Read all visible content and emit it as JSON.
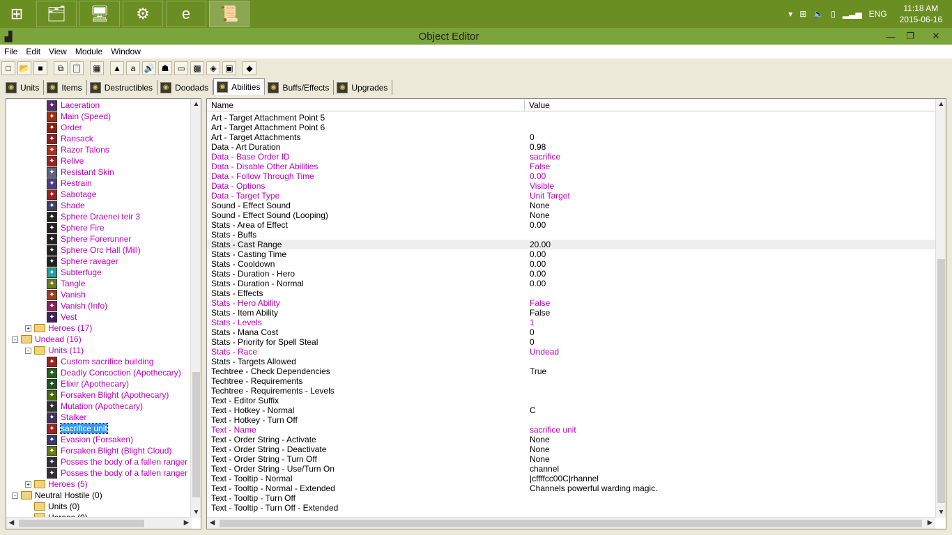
{
  "taskbar": {
    "apps": [
      {
        "name": "start-button",
        "glyph": "⊞"
      },
      {
        "name": "file-explorer",
        "glyph": "🗂"
      },
      {
        "name": "system-monitor",
        "glyph": "🖥"
      },
      {
        "name": "control-panel",
        "glyph": "⚙"
      },
      {
        "name": "internet-explorer",
        "glyph": "e"
      },
      {
        "name": "world-editor",
        "glyph": "📜"
      }
    ],
    "language": "ENG",
    "time": "11:18 AM",
    "date": "2015-06-16"
  },
  "window": {
    "title": "Object Editor"
  },
  "menu": [
    "File",
    "Edit",
    "View",
    "Module",
    "Window"
  ],
  "tabs": [
    {
      "label": "Units",
      "active": false
    },
    {
      "label": "Items",
      "active": false
    },
    {
      "label": "Destructibles",
      "active": false
    },
    {
      "label": "Doodads",
      "active": false
    },
    {
      "label": "Abilities",
      "active": true
    },
    {
      "label": "Buffs/Effects",
      "active": false
    },
    {
      "label": "Upgrades",
      "active": false
    }
  ],
  "tree": [
    {
      "label": "Laceration",
      "indent": 3,
      "icon": "#5a2a6a"
    },
    {
      "label": "Main (Speed)",
      "indent": 3,
      "icon": "#a03010"
    },
    {
      "label": "Order",
      "indent": 3,
      "icon": "#8a2010"
    },
    {
      "label": "Ransack",
      "indent": 3,
      "icon": "#902020"
    },
    {
      "label": "Razor Talons",
      "indent": 3,
      "icon": "#b03020"
    },
    {
      "label": "Relive",
      "indent": 3,
      "icon": "#a02020"
    },
    {
      "label": "Resistant Skin",
      "indent": 3,
      "icon": "#606080"
    },
    {
      "label": "Restrain",
      "indent": 3,
      "icon": "#4a3a8a"
    },
    {
      "label": "Sabotage",
      "indent": 3,
      "icon": "#a02020"
    },
    {
      "label": "Shade",
      "indent": 3,
      "icon": "#404060"
    },
    {
      "label": "Sphere Draenei teir 3",
      "indent": 3,
      "icon": "#222222"
    },
    {
      "label": "Sphere Fire",
      "indent": 3,
      "icon": "#222222"
    },
    {
      "label": "Sphere Forerunner",
      "indent": 3,
      "icon": "#222222"
    },
    {
      "label": "Sphere Orc Hall (Mill)",
      "indent": 3,
      "icon": "#222222"
    },
    {
      "label": "Sphere ravager",
      "indent": 3,
      "icon": "#222222"
    },
    {
      "label": "Subterfuge",
      "indent": 3,
      "icon": "#20a0a0"
    },
    {
      "label": "Tangle",
      "indent": 3,
      "icon": "#6a7a20"
    },
    {
      "label": "Vanish",
      "indent": 3,
      "icon": "#a04020"
    },
    {
      "label": "Vanish (Info)",
      "indent": 3,
      "icon": "#8a2060"
    },
    {
      "label": "Vest",
      "indent": 3,
      "icon": "#402060"
    },
    {
      "label": "Heroes (17)",
      "indent": 2,
      "folder": true,
      "exp": "+"
    },
    {
      "label": "Undead (16)",
      "indent": 1,
      "folder": true,
      "exp": "-"
    },
    {
      "label": "Units (11)",
      "indent": 2,
      "folder": true,
      "exp": "-"
    },
    {
      "label": "Custom sacrifice building",
      "indent": 3,
      "icon": "#a02020"
    },
    {
      "label": "Deadly Concoction (Apothecary)",
      "indent": 3,
      "icon": "#206020"
    },
    {
      "label": "Elixir (Apothecary)",
      "indent": 3,
      "icon": "#205020"
    },
    {
      "label": "Forsaken Blight (Apothecary)",
      "indent": 3,
      "icon": "#4a6a10"
    },
    {
      "label": "Mutation (Apothecary)",
      "indent": 3,
      "icon": "#303030"
    },
    {
      "label": "Stalker",
      "indent": 3,
      "icon": "#403060"
    },
    {
      "label": "sacrifice unit",
      "indent": 3,
      "icon": "#a02020",
      "selected": true
    },
    {
      "label": "Evasion (Forsaken)",
      "indent": 3,
      "icon": "#3a3a6a"
    },
    {
      "label": "Forsaken Blight  (Blight Cloud)",
      "indent": 3,
      "icon": "#6a7a10"
    },
    {
      "label": "Posses the body of a fallen ranger (Ban",
      "indent": 3,
      "icon": "#303030"
    },
    {
      "label": "Posses the body of a fallen ranger (Tom",
      "indent": 3,
      "icon": "#303030"
    },
    {
      "label": "Heroes (5)",
      "indent": 2,
      "folder": true,
      "exp": "+"
    },
    {
      "label": "Neutral Hostile (0)",
      "indent": 1,
      "folder": true,
      "exp": "-",
      "black": true
    },
    {
      "label": "Units (0)",
      "indent": 2,
      "folder": true,
      "black": true
    },
    {
      "label": "Heroes (0)",
      "indent": 2,
      "folder": true,
      "black": true
    }
  ],
  "props_header": {
    "name": "Name",
    "value": "Value"
  },
  "props": [
    {
      "n": "Art - Target Attachment Point 5",
      "v": ""
    },
    {
      "n": "Art - Target Attachment Point 6",
      "v": ""
    },
    {
      "n": "Art - Target Attachments",
      "v": "0"
    },
    {
      "n": "Data - Art Duration",
      "v": "0.98"
    },
    {
      "n": "Data - Base Order ID",
      "v": "sacrifice",
      "mod": true
    },
    {
      "n": "Data - Disable Other Abilities",
      "v": "False",
      "mod": true
    },
    {
      "n": "Data - Follow Through Time",
      "v": "0.00",
      "mod": true
    },
    {
      "n": "Data - Options",
      "v": "Visible",
      "mod": true
    },
    {
      "n": "Data - Target Type",
      "v": "Unit Target",
      "mod": true
    },
    {
      "n": "Sound - Effect Sound",
      "v": "None"
    },
    {
      "n": "Sound - Effect Sound (Looping)",
      "v": "None"
    },
    {
      "n": "Stats - Area of Effect",
      "v": "0.00"
    },
    {
      "n": "Stats - Buffs",
      "v": ""
    },
    {
      "n": "Stats - Cast Range",
      "v": "20.00",
      "hl": true
    },
    {
      "n": "Stats - Casting Time",
      "v": "0.00"
    },
    {
      "n": "Stats - Cooldown",
      "v": "0.00"
    },
    {
      "n": "Stats - Duration - Hero",
      "v": "0.00"
    },
    {
      "n": "Stats - Duration - Normal",
      "v": "0.00"
    },
    {
      "n": "Stats - Effects",
      "v": ""
    },
    {
      "n": "Stats - Hero Ability",
      "v": "False",
      "mod": true
    },
    {
      "n": "Stats - Item Ability",
      "v": "False"
    },
    {
      "n": "Stats - Levels",
      "v": "1",
      "mod": true
    },
    {
      "n": "Stats - Mana Cost",
      "v": "0"
    },
    {
      "n": "Stats - Priority for Spell Steal",
      "v": "0"
    },
    {
      "n": "Stats - Race",
      "v": "Undead",
      "mod": true
    },
    {
      "n": "Stats - Targets Allowed",
      "v": ""
    },
    {
      "n": "Techtree - Check Dependencies",
      "v": "True"
    },
    {
      "n": "Techtree - Requirements",
      "v": ""
    },
    {
      "n": "Techtree - Requirements - Levels",
      "v": ""
    },
    {
      "n": "Text - Editor Suffix",
      "v": ""
    },
    {
      "n": "Text - Hotkey - Normal",
      "v": "C"
    },
    {
      "n": "Text - Hotkey - Turn Off",
      "v": ""
    },
    {
      "n": "Text - Name",
      "v": "sacrifice unit",
      "mod": true
    },
    {
      "n": "Text - Order String - Activate",
      "v": "None"
    },
    {
      "n": "Text - Order String - Deactivate",
      "v": "None"
    },
    {
      "n": "Text - Order String - Turn Off",
      "v": "None"
    },
    {
      "n": "Text - Order String - Use/Turn On",
      "v": "channel"
    },
    {
      "n": "Text - Tooltip - Normal",
      "v": "|cffffcc00C|rhannel"
    },
    {
      "n": "Text - Tooltip - Normal - Extended",
      "v": "Channels powerful warding magic."
    },
    {
      "n": "Text - Tooltip - Turn Off",
      "v": ""
    },
    {
      "n": "Text - Tooltip - Turn Off - Extended",
      "v": ""
    }
  ]
}
